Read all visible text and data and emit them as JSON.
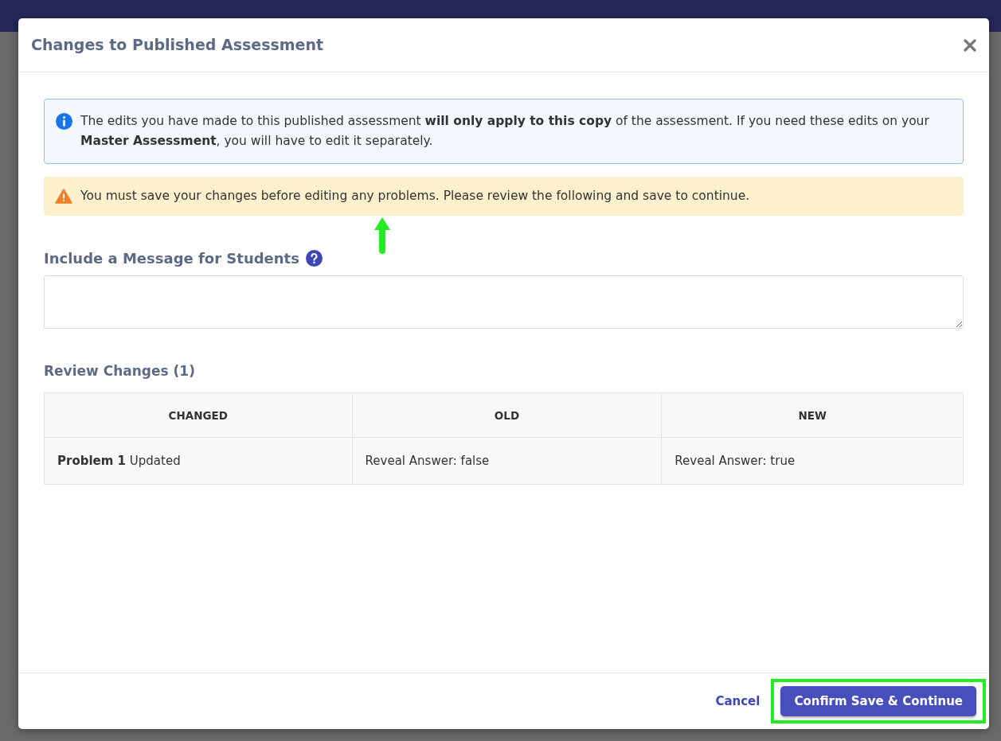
{
  "modal": {
    "title": "Changes to Published Assessment",
    "info_alert": "The edits you have made to this published assessment **will only apply to this copy** of the assessment. If you need these edits on your **Master Assessment**, you will have to edit it separately.",
    "warning_alert": "You must save your changes before editing any problems. Please review the following and save to continue.",
    "message_label": "Include a Message for Students",
    "review_title": "Review Changes (1)",
    "table": {
      "columns": [
        "CHANGED",
        "OLD",
        "NEW"
      ],
      "rows": [
        [
          "**Problem 1** Updated",
          "Reveal Answer: false",
          "Reveal Answer: true"
        ]
      ]
    },
    "buttons": [
      {
        "label": "Cancel",
        "kind": "link",
        "highlighted": false
      },
      {
        "label": "Confirm Save & Continue",
        "kind": "primary",
        "highlighted": true
      }
    ]
  }
}
